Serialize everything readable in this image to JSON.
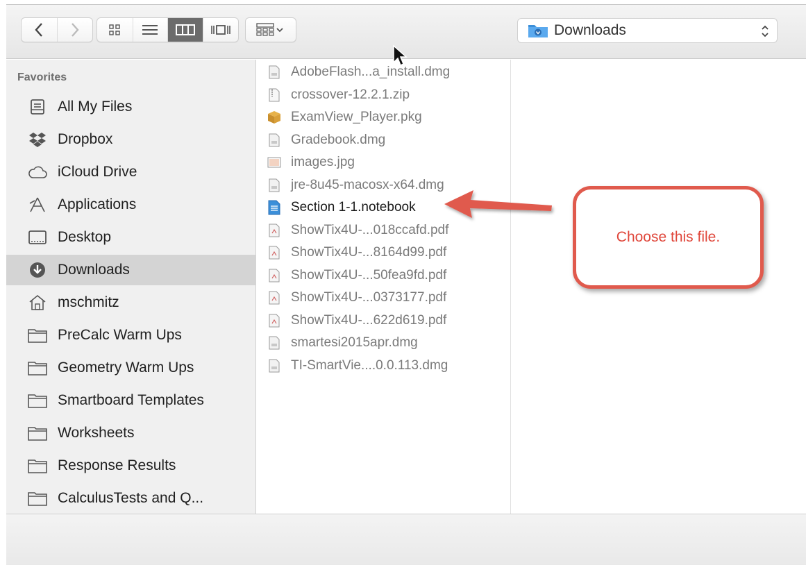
{
  "toolbar": {
    "back_icon": "chevron-left-icon",
    "forward_icon": "chevron-right-icon",
    "view_modes": [
      "icon-view-icon",
      "list-view-icon",
      "column-view-icon",
      "cover-flow-icon"
    ],
    "selected_view": "column",
    "arrange_icon": "arrange-grid-icon",
    "path_label": "Downloads"
  },
  "sidebar": {
    "section_title": "Favorites",
    "items": [
      {
        "label": "All My Files",
        "icon": "all-files-icon"
      },
      {
        "label": "Dropbox",
        "icon": "dropbox-icon"
      },
      {
        "label": "iCloud Drive",
        "icon": "cloud-icon"
      },
      {
        "label": "Applications",
        "icon": "applications-icon"
      },
      {
        "label": "Desktop",
        "icon": "desktop-icon"
      },
      {
        "label": "Downloads",
        "icon": "downloads-icon",
        "selected": true
      },
      {
        "label": "mschmitz",
        "icon": "home-icon"
      },
      {
        "label": "PreCalc Warm Ups",
        "icon": "folder-icon"
      },
      {
        "label": "Geometry Warm Ups",
        "icon": "folder-icon"
      },
      {
        "label": "Smartboard Templates",
        "icon": "folder-icon"
      },
      {
        "label": "Worksheets",
        "icon": "folder-icon"
      },
      {
        "label": "Response Results",
        "icon": "folder-icon"
      },
      {
        "label": "CalculusTests and Q...",
        "icon": "folder-icon"
      }
    ]
  },
  "files": [
    {
      "name": "AdobeFlash...a_install.dmg",
      "icon": "disk-image-icon"
    },
    {
      "name": "crossover-12.2.1.zip",
      "icon": "zip-icon"
    },
    {
      "name": "ExamView_Player.pkg",
      "icon": "package-icon"
    },
    {
      "name": "Gradebook.dmg",
      "icon": "disk-image-icon"
    },
    {
      "name": "images.jpg",
      "icon": "image-icon"
    },
    {
      "name": "jre-8u45-macosx-x64.dmg",
      "icon": "disk-image-icon"
    },
    {
      "name": "Section 1-1.notebook",
      "icon": "notebook-icon",
      "active": true
    },
    {
      "name": "ShowTix4U-...018ccafd.pdf",
      "icon": "pdf-icon"
    },
    {
      "name": "ShowTix4U-...8164d99.pdf",
      "icon": "pdf-icon"
    },
    {
      "name": "ShowTix4U-...50fea9fd.pdf",
      "icon": "pdf-icon"
    },
    {
      "name": "ShowTix4U-...0373177.pdf",
      "icon": "pdf-icon"
    },
    {
      "name": "ShowTix4U-...622d619.pdf",
      "icon": "pdf-icon"
    },
    {
      "name": "smartesi2015apr.dmg",
      "icon": "disk-image-icon"
    },
    {
      "name": "TI-SmartVie....0.0.113.dmg",
      "icon": "disk-image-icon"
    }
  ],
  "annotation": {
    "text": "Choose this file.",
    "color": "#e05a4d"
  },
  "colors": {
    "accent_blue": "#3b8fd9",
    "selection_gray": "#d4d4d4",
    "dimmed_text": "#7a7a7a"
  }
}
